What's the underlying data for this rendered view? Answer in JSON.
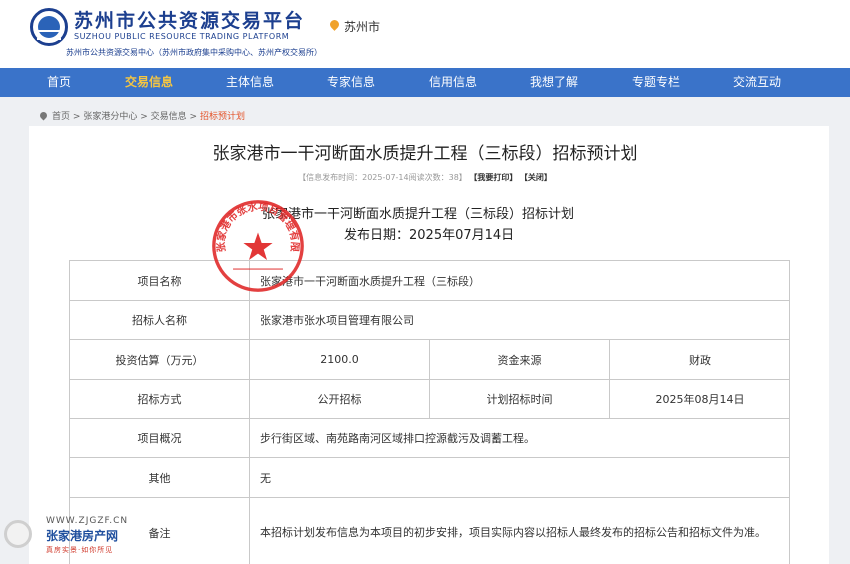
{
  "header": {
    "title": "苏州市公共资源交易平台",
    "title_en": "SUZHOU PUBLIC RESOURCE TRADING PLATFORM",
    "subtitle": "苏州市公共资源交易中心（苏州市政府集中采购中心、苏州产权交易所）",
    "location": "苏州市"
  },
  "nav": {
    "items": [
      {
        "label": "首页"
      },
      {
        "label": "交易信息"
      },
      {
        "label": "主体信息"
      },
      {
        "label": "专家信息"
      },
      {
        "label": "信用信息"
      },
      {
        "label": "我想了解"
      },
      {
        "label": "专题专栏"
      },
      {
        "label": "交流互动"
      }
    ],
    "active_index": 1
  },
  "breadcrumb": {
    "items": [
      "首页",
      "张家港分中心",
      "交易信息",
      "招标预计划"
    ],
    "separator": ">"
  },
  "article": {
    "title": "张家港市一干河断面水质提升工程（三标段）招标预计划",
    "meta": "【信息发布时间：2025-07-14阅读次数：38】",
    "print_label": "【我要打印】",
    "close_label": "【关闭】"
  },
  "document": {
    "title": "张家港市一干河断面水质提升工程（三标段）招标计划",
    "date": "发布日期：2025年07月14日",
    "stamp_text": "张家港市张水项目管理有限公司"
  },
  "table": {
    "project_name_label": "项目名称",
    "project_name": "张家港市一干河断面水质提升工程（三标段）",
    "tenderer_label": "招标人名称",
    "tenderer": "张家港市张水项目管理有限公司",
    "investment_label": "投资估算（万元）",
    "investment": "2100.0",
    "funding_label": "资金来源",
    "funding": "财政",
    "method_label": "招标方式",
    "method": "公开招标",
    "planned_time_label": "计划招标时间",
    "planned_time": "2025年08月14日",
    "overview_label": "项目概况",
    "overview": "步行街区域、南苑路南河区域排口控源截污及调蓄工程。",
    "other_label": "其他",
    "other": "无",
    "remarks_label": "备注",
    "remarks": "本招标计划发布信息为本项目的初步安排，项目实际内容以招标人最终发布的招标公告和招标文件为准。"
  },
  "watermark": {
    "url": "WWW.ZJGZF.CN",
    "name": "张家港房产网",
    "slogan": "真房实景·如你所见"
  },
  "colors": {
    "nav_bg": "#3a73c9",
    "nav_active": "#f5c642",
    "brand_blue": "#1c3f8f",
    "stamp_red": "#e02b2b",
    "crumb_current": "#e4542a"
  },
  "icons": {
    "logo": "platform-logo-icon",
    "location": "map-pin-icon",
    "breadcrumb": "location-pin-icon",
    "stamp_star": "star-icon"
  }
}
